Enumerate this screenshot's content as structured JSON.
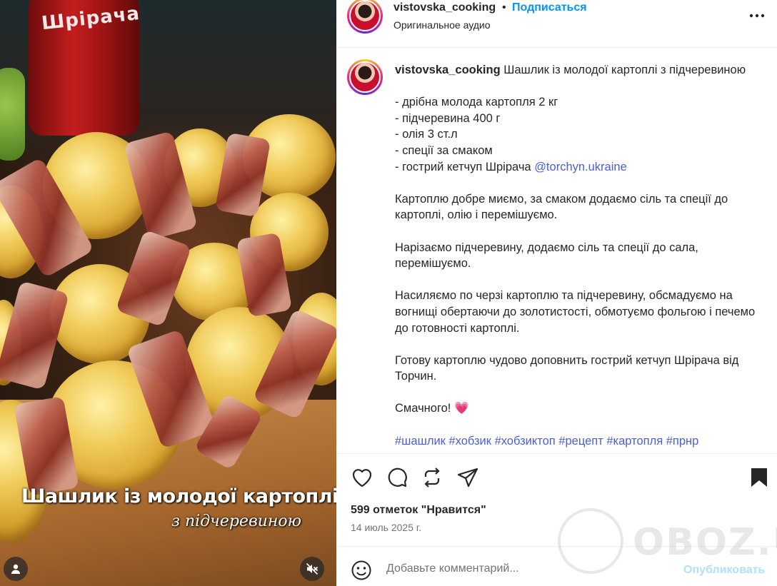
{
  "media": {
    "bottle_label": "Шрірача",
    "overlay_title": "Шашлик із молодої картоплі",
    "overlay_subtitle": "з підчеревиною"
  },
  "header": {
    "username": "vistovska_cooking",
    "separator": "•",
    "follow_label": "Подписаться",
    "audio_label": "Оригинальное аудио"
  },
  "caption": {
    "username": "vistovska_cooking",
    "title": "Шашлик із молодої картоплі з підчеревиною",
    "ingredients": [
      "- дрібна молода картопля 2 кг",
      "- підчеревина 400 г",
      "- олія 3 ст.л",
      "- спеції за смаком"
    ],
    "ketchup_line": "- гострий кетчуп Шрірача ",
    "mention": "@torchyn.ukraine",
    "paragraphs": [
      "Картоплю добре миємо, за смаком додаємо сіль та спеції до картоплі, олію і перемішуємо.",
      "Нарізаємо підчеревину, додаємо сіль та спеції до сала, перемішуємо.",
      "Насиляємо по черзі картоплю та підчеревину, обсмадуємо на вогнищі обертаючи до золотистості, обмотуємо фольгою і печемо до готовності картоплі.",
      "Готову картоплю чудово доповнить гострий кетчуп Шрірача від Торчин."
    ],
    "closing": "Смачного! ",
    "closing_emoji": "💗",
    "hashtags_partial": "#шашлик #хобзик #хобзиктоп #рецепт #картопля #прнр"
  },
  "actions": {
    "likes": "599 отметок \"Нравится\"",
    "date": "14 июль 2025 г."
  },
  "comment": {
    "placeholder": "Добавьте комментарий...",
    "publish_label": "Опубликовать"
  },
  "watermark": {
    "text": "OBOZ.UA"
  },
  "colors": {
    "link_blue": "#0095f6",
    "mention_blue": "#4a5ed6",
    "publish_disabled": "#b2dffc",
    "muted_text": "#737373"
  }
}
